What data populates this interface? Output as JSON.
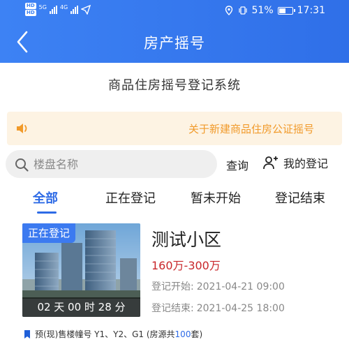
{
  "status_bar": {
    "hd1": "HD",
    "hd2": "HD",
    "net1": "5G",
    "net2": "4G",
    "battery_text": "51%",
    "battery_level": 0.51,
    "time": "17:31"
  },
  "header": {
    "title": "房产摇号"
  },
  "system_title": "商品住房摇号登记系统",
  "notice": {
    "text": "关于新建商品住房公证摇号"
  },
  "search": {
    "placeholder": "楼盘名称"
  },
  "actions": {
    "query": "查询",
    "my_registration": "我的登记"
  },
  "tabs": [
    {
      "label": "全部",
      "active": true
    },
    {
      "label": "正在登记",
      "active": false
    },
    {
      "label": "暂未开始",
      "active": false
    },
    {
      "label": "登记结束",
      "active": false
    }
  ],
  "listing": {
    "status": "正在登记",
    "countdown": "02 天 00 时 28 分",
    "name": "测试小区",
    "price": "160万-300万",
    "reg_start_label": "登记开始:",
    "reg_start": "2021-04-21 09:00",
    "reg_end_label": "登记结束:",
    "reg_end": "2021-04-25 18:00",
    "buildings_prefix": "预(现)售楼幢号 Y1、Y2、G1 (房源共",
    "units_count": "100",
    "units_suffix": "套)"
  },
  "colors": {
    "header_blue": "#3d82f4",
    "accent_blue": "#2e6be6",
    "price_red": "#c8262a",
    "notice_orange": "#f19a2a",
    "notice_bg": "#fdf3e3"
  }
}
